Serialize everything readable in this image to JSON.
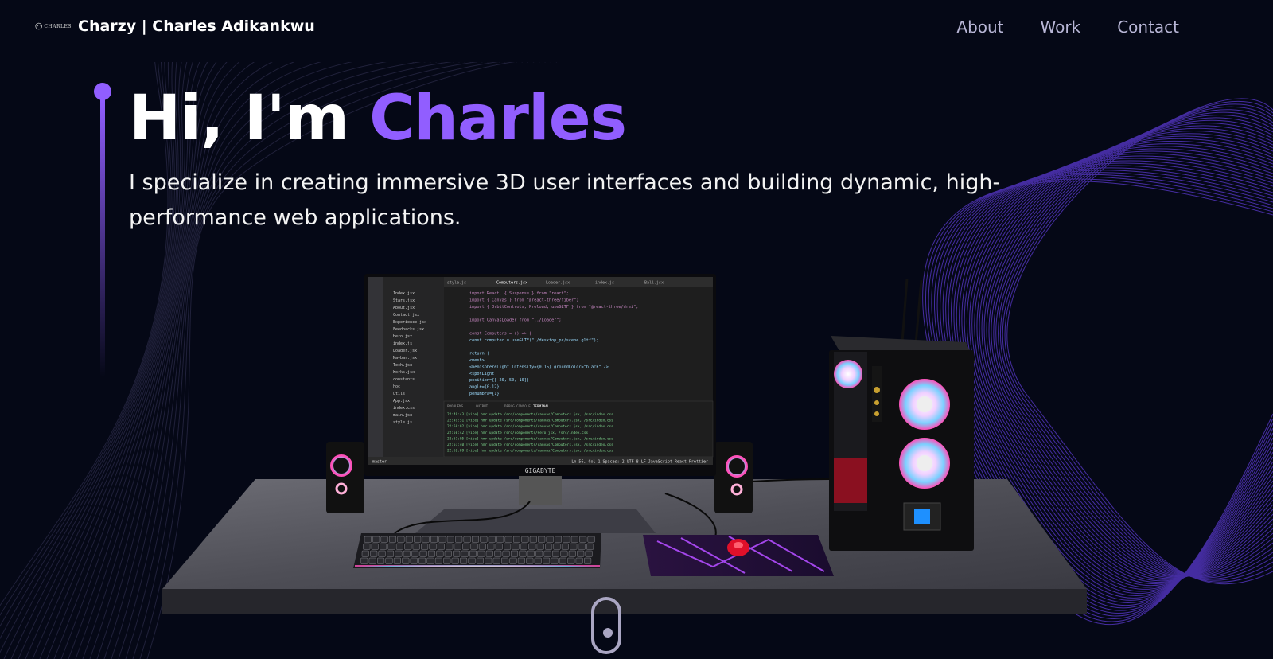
{
  "nav": {
    "logo_text": "CHARLES",
    "brand_name": "Charzy",
    "brand_owner": "| Charles Adikankwu",
    "links": [
      "About",
      "Work",
      "Contact"
    ]
  },
  "hero": {
    "greeting": "Hi, I'm ",
    "name": "Charles",
    "subtitle": "I specialize in creating immersive 3D user interfaces and building dynamic, high-performance web applications."
  },
  "scene": {
    "monitor_brand": "GIGABYTE",
    "editor_tabs": [
      "style.js",
      "Computers.jsx",
      "Loader.jsx",
      "index.js",
      "Ball.jsx"
    ],
    "code_lines": [
      "import React, { Suspense } from \"react\";",
      "import { Canvas } from \"@react-three/fiber\";",
      "import { OrbitControls, Preload, useGLTF } from \"@react-three/drei\";",
      "",
      "import CanvasLoader from \"../Loader\";",
      "",
      "const Computers = () => {",
      "  const computer = useGLTF(\"./desktop_pc/scene.gltf\");",
      "",
      "  return (",
      "    <mesh>",
      "      <hemisphereLight intensity={0.15} groundColor=\"black\" />",
      "      <spotLight",
      "        position={[-20, 50, 10]}",
      "        angle={0.12}",
      "        penumbra={1}"
    ],
    "explorer_items": [
      "Index.jsx",
      "Stars.jsx",
      "About.jsx",
      "Contact.jsx",
      "Experience.jsx",
      "Feedbacks.jsx",
      "Hero.jsx",
      "index.js",
      "Loader.jsx",
      "Navbar.jsx",
      "Tech.jsx",
      "Works.jsx",
      "constants",
      "hoc",
      "utils",
      "App.jsx",
      "index.css",
      "main.jsx",
      "style.js"
    ],
    "terminal_tabs": [
      "PROBLEMS",
      "OUTPUT",
      "DEBUG CONSOLE",
      "TERMINAL"
    ],
    "terminal_lines": [
      "22:49:43 [vite] hmr update /src/components/canvas/Computers.jsx, /src/index.css",
      "22:49:51 [vite] hmr update /src/components/canvas/Computers.jsx, /src/index.css",
      "22:50:02 [vite] hmr update /src/components/canvas/Computers.jsx, /src/index.css",
      "22:50:42 [vite] hmr update /src/components/Hero.jsx, /src/index.css",
      "22:51:05 [vite] hmr update /src/components/canvas/Computers.jsx, /src/index.css",
      "22:51:40 [vite] hmr update /src/components/canvas/Computers.jsx, /src/index.css",
      "22:52:09 [vite] hmr update /src/components/canvas/Computers.jsx, /src/index.css"
    ],
    "status_left": "master",
    "status_right": "Ln 56, Col 1  Spaces: 2  UTF-8  LF  JavaScript React  Prettier"
  },
  "colors": {
    "background": "#050816",
    "accent": "#915eff",
    "nav_link": "#b8b6d6",
    "scroll_indicator": "#aaa6c3"
  },
  "icons": [
    "charles-logo-icon",
    "scroll-indicator-icon"
  ]
}
